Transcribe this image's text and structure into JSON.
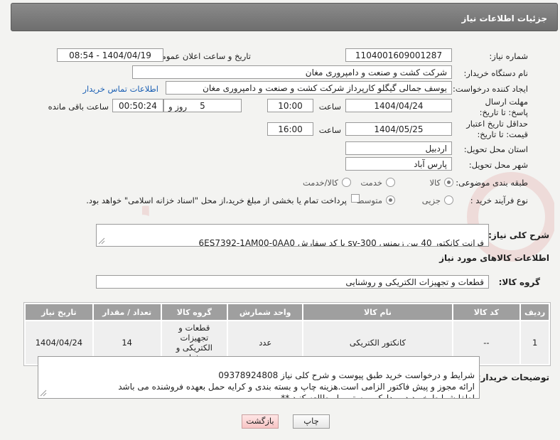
{
  "header": {
    "title": "جزئیات اطلاعات نیاز"
  },
  "form": {
    "need_number": {
      "label": "شماره نیاز:",
      "value": "1104001609001287"
    },
    "announce_datetime": {
      "label": "تاریخ و ساعت اعلان عمومی:",
      "value": "1404/04/19 - 08:54"
    },
    "buyer_org": {
      "label": "نام دستگاه خریدار:",
      "value": "شرکت کشت و صنعت و دامپروری مغان"
    },
    "requester": {
      "label": "ایجاد کننده درخواست:",
      "value": "یوسف جمالی گیگلو کارپرداز شرکت کشت و صنعت و دامپروری مغان",
      "contact_link": "اطلاعات تماس خریدار"
    },
    "reply_deadline": {
      "label": "مهلت ارسال پاسخ: تا تاریخ:",
      "date": "1404/04/24",
      "time_label": "ساعت",
      "time": "10:00",
      "days": "5",
      "days_label": "روز و",
      "remaining": "00:50:24",
      "remaining_label": "ساعت باقی مانده"
    },
    "price_validity": {
      "label": "حداقل تاریخ اعتبار قیمت: تا تاریخ:",
      "date": "1404/05/25",
      "time_label": "ساعت",
      "time": "16:00"
    },
    "delivery_province": {
      "label": "استان محل تحویل:",
      "value": "اردبیل"
    },
    "delivery_city": {
      "label": "شهر محل تحویل:",
      "value": "پارس آباد"
    },
    "category": {
      "label": "طبقه بندی موضوعی:",
      "options": [
        "کالا",
        "خدمت",
        "کالا/خدمت"
      ],
      "selected": 0
    },
    "process_type": {
      "label": "نوع فرآیند خرید :",
      "options": [
        "جزیی",
        "متوسط"
      ],
      "selected": 1,
      "payment_note": "پرداخت تمام یا بخشی از مبلغ خرید،از محل \"اسناد خزانه اسلامی\" خواهد بود."
    }
  },
  "description": {
    "label": "شرح کلی نیاز:",
    "value": "فرانت کانکتور 40 پین زیمنس sv-300 با کد سفارش 6ES7392-1AM00-0AA0"
  },
  "goods_info": {
    "title": "اطلاعات کالاهای مورد نیاز",
    "group_label": "گروه کالا:",
    "group_value": "قطعات و تجهیزات الکتریکی و روشنایی",
    "table": {
      "headers": [
        "ردیف",
        "کد کالا",
        "نام کالا",
        "واحد شمارش",
        "گروه کالا",
        "تعداد / مقدار",
        "تاریخ نیاز"
      ],
      "rows": [
        [
          "1",
          "--",
          "کانکتور الکتریکی",
          "عدد",
          "قطعات و تجهیزات الکتریکی و روشنایی",
          "14",
          "1404/04/24"
        ]
      ]
    }
  },
  "buyer_notes": {
    "label": "توضیحات خریدار:",
    "value": "شرایط و درخواست خرید طبق پیوست و شرح کلی نیاز 09378924808\nارائه مجوز و پیش فاکتور الزامی است.هزینه چاپ و بسته بندی و کرایه حمل بعهده فروشنده می باشد\nلطفا شرایط خرید در مدارک پیوستی را مطالعه کنید **"
  },
  "buttons": {
    "print": "چاپ",
    "back": "بازگشت"
  },
  "colors": {
    "title_bar": "#7c7c7c",
    "link": "#1a5fb4",
    "table_header": "#9f9f9f",
    "back_button": "#f7c4c4"
  }
}
